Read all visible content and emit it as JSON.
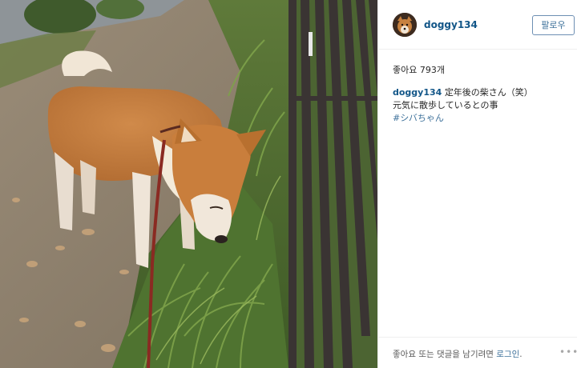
{
  "post": {
    "username": "doggy134",
    "follow_label": "팔로우",
    "likes_text": "좋아요 793개",
    "caption": {
      "username": "doggy134",
      "line1": "定年後の柴さん（笑）",
      "line2": "元気に散歩しているとの事",
      "hashtag": "#シバちゃん"
    },
    "footer": {
      "prefix": "좋아요 또는 댓글을 남기려면 ",
      "login_label": "로그인",
      "suffix": "."
    },
    "more_icon": "more-dots-icon"
  },
  "colors": {
    "username": "#125688",
    "link": "#3f729b",
    "border": "#efefef"
  }
}
